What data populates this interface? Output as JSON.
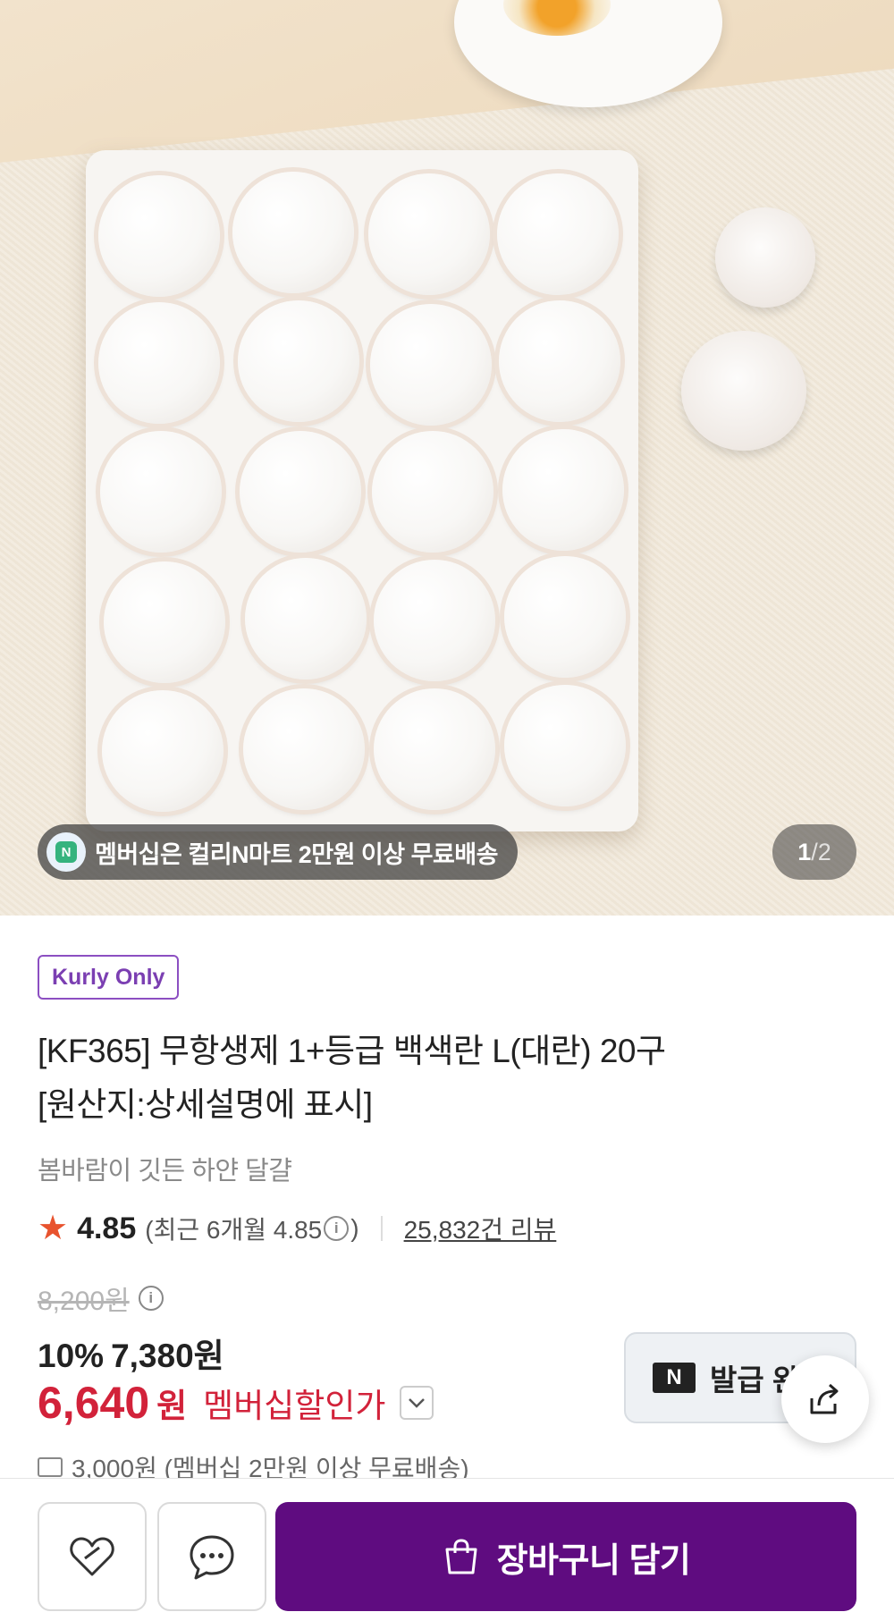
{
  "hero": {
    "banner_text": "멤버십은 컬리N마트 2만원 이상 무료배송",
    "badge_letter": "N",
    "pager_current": "1",
    "pager_sep": "/",
    "pager_total": "2"
  },
  "product": {
    "tag": "Kurly Only",
    "title_line1": "[KF365] 무항생제 1+등급 백색란 L(대란) 20구",
    "title_line2": "[원산지:상세설명에 표시]",
    "subtitle": "봄바람이 깃든 하얀 달걀",
    "rating": {
      "score": "4.85",
      "recent_prefix": "(최근 6개월 4.85",
      "recent_suffix": ")",
      "info_glyph": "i",
      "reviews": "25,832건 리뷰"
    },
    "price": {
      "original": "8,200원",
      "discount_rate": "10%",
      "discounted": "7,380원",
      "member_amount": "6,640",
      "member_won": "원",
      "member_label": "멤버십할인가"
    },
    "coupon": {
      "logo": "N",
      "label": "발급 완"
    },
    "shipping": "3,000원 (멤버십 2만원 이상 무료배송)"
  },
  "actions": {
    "cart_label": "장바구니 담기"
  },
  "colors": {
    "brand_purple": "#5f0c80",
    "discount_red": "#d2223a",
    "star": "#e8532e"
  }
}
